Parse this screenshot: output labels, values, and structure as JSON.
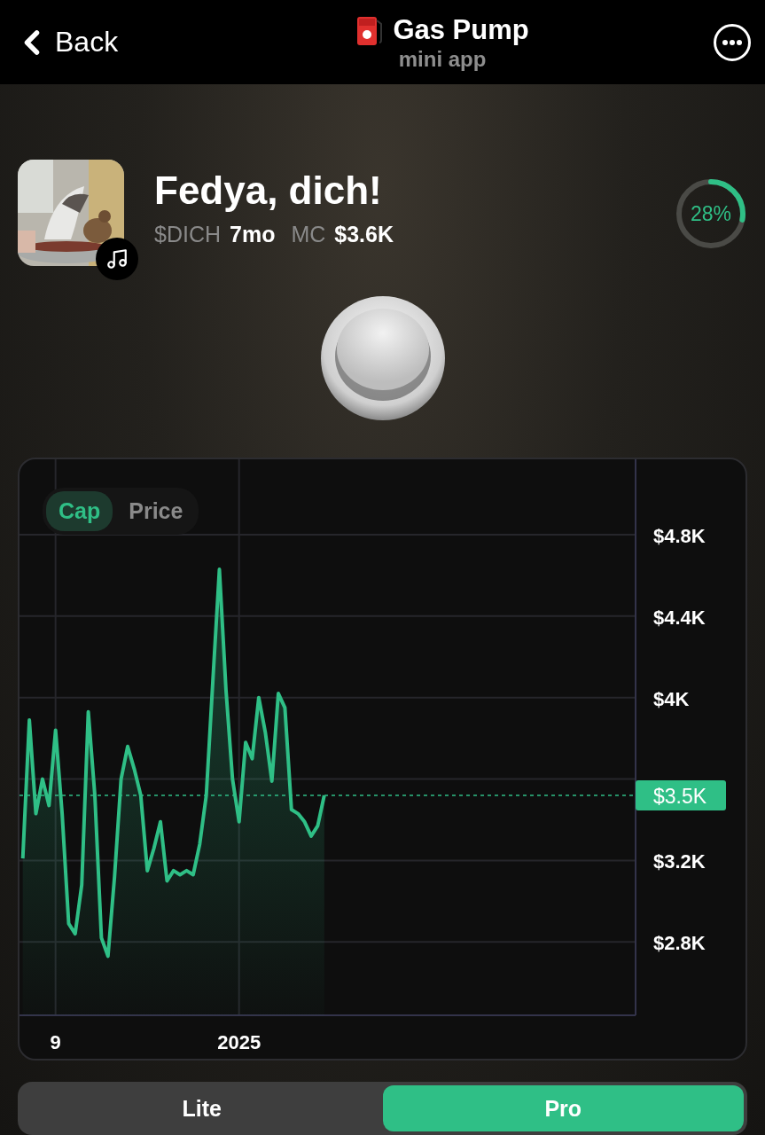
{
  "header": {
    "back": "Back",
    "title": "Gas Pump",
    "subtitle": "mini app"
  },
  "token": {
    "name": "Fedya, dich!",
    "ticker": "$DICH",
    "age": "7mo",
    "mc_label": "MC",
    "mc_value": "$3.6K",
    "progress": {
      "level": 0.28,
      "label": "28%"
    }
  },
  "chart": {
    "tabs": [
      {
        "label": "Cap",
        "selected": true
      },
      {
        "label": "Price",
        "selected": false
      }
    ],
    "price_tag": "$3.5K",
    "chart_data": {
      "type": "area",
      "ylim": [
        2.44,
        5.17
      ],
      "grid": true,
      "ref_lines": [
        {
          "axis": "y",
          "value": 3.52
        }
      ],
      "categories": [
        null,
        null,
        null,
        null,
        null,
        "9",
        null,
        null,
        null,
        null,
        null,
        null,
        null,
        null,
        null,
        null,
        null,
        null,
        null,
        null,
        null,
        null,
        null,
        null,
        null,
        null,
        null,
        null,
        null,
        null,
        null,
        null,
        null,
        "2025",
        null,
        null,
        null,
        null,
        null,
        null,
        null,
        null,
        null,
        null,
        null,
        null,
        null,
        null,
        null,
        null,
        null,
        null,
        null,
        null,
        null,
        null,
        null,
        null,
        null,
        null,
        null,
        null,
        null,
        null,
        null,
        null,
        null,
        null,
        null,
        null,
        null,
        null,
        null,
        null,
        null,
        null,
        null,
        null,
        null,
        null,
        null,
        null,
        null,
        null,
        null,
        null,
        null,
        null,
        null,
        null,
        null,
        null,
        null,
        null
      ],
      "yticks": [
        {
          "value": 2.8,
          "label": "$2.8K"
        },
        {
          "value": 3.2,
          "label": "$3.2K"
        },
        {
          "value": 4.0,
          "label": "$4K"
        },
        {
          "value": 4.4,
          "label": "$4.4K"
        },
        {
          "value": 4.8,
          "label": "$4.8K"
        }
      ],
      "series": [
        {
          "color": "#2fbf86",
          "values": [
            3.21,
            3.89,
            3.43,
            3.6,
            3.47,
            3.84,
            3.43,
            2.89,
            2.84,
            3.08,
            3.93,
            3.52,
            2.82,
            2.73,
            3.12,
            3.6,
            3.76,
            3.65,
            3.52,
            3.15,
            3.26,
            3.39,
            3.1,
            3.15,
            3.13,
            3.15,
            3.13,
            3.28,
            3.52,
            4.08,
            4.63,
            4.04,
            3.6,
            3.39,
            3.78,
            3.7,
            4.0,
            3.83,
            3.59,
            4.02,
            3.95,
            3.45,
            3.43,
            3.39,
            3.32,
            3.37,
            3.52,
            null,
            null,
            null,
            null,
            null,
            null,
            null,
            null,
            null,
            null,
            null,
            null,
            null,
            null,
            null,
            null,
            null,
            null,
            null,
            null,
            null,
            null,
            null,
            null,
            null,
            null,
            null,
            null,
            null,
            null,
            null,
            null,
            null,
            null,
            null,
            null,
            null,
            null,
            null,
            null,
            null,
            null,
            null,
            null,
            null,
            null,
            null
          ]
        }
      ]
    }
  },
  "modes": [
    {
      "label": "Lite",
      "selected": false
    },
    {
      "label": "Pro",
      "selected": true
    }
  ]
}
